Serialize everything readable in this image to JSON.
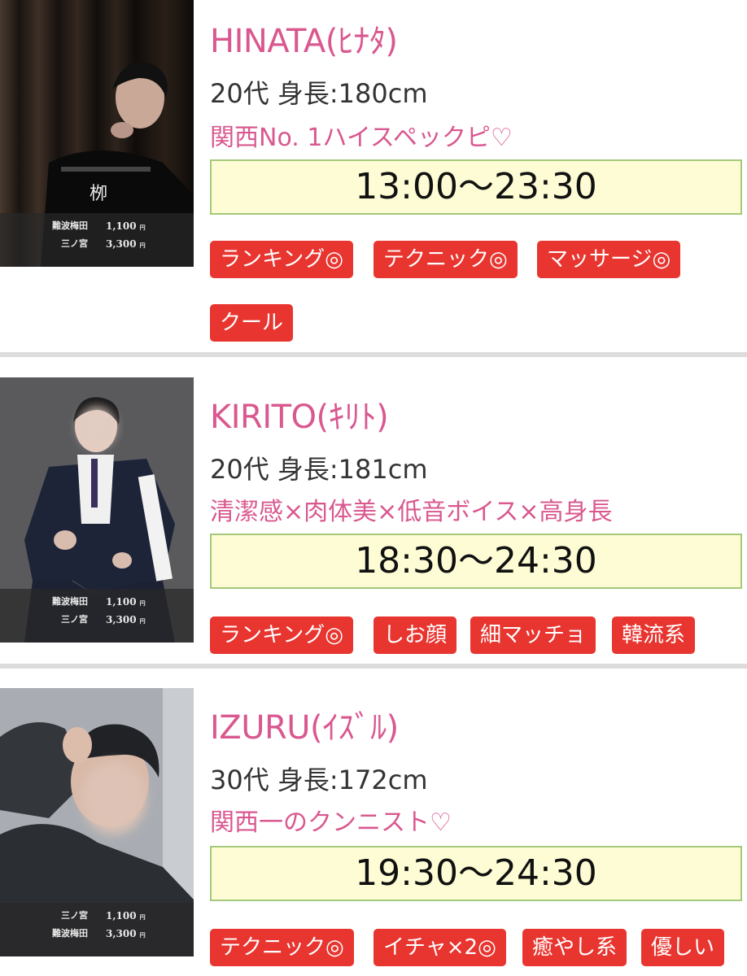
{
  "cast": [
    {
      "name": "HINATA(ﾋﾅﾀ)",
      "stats": "20代 身長:180cm",
      "catch": "関西No. 1ハイスペックピ♡",
      "schedule": "13:00〜23:30",
      "prices": [
        {
          "location": "難波梅田",
          "price": "1,100",
          "unit": "円"
        },
        {
          "location": "三ノ宮",
          "price": "3,300",
          "unit": "円"
        }
      ],
      "tags": [
        "ランキング◎",
        "テクニック◎",
        "マッサージ◎",
        "クール"
      ]
    },
    {
      "name": "KIRITO(ｷﾘﾄ)",
      "stats": "20代 身長:181cm",
      "catch": "清潔感×肉体美×低音ボイス×高身長",
      "schedule": "18:30〜24:30",
      "prices": [
        {
          "location": "難波梅田",
          "price": "1,100",
          "unit": "円"
        },
        {
          "location": "三ノ宮",
          "price": "3,300",
          "unit": "円"
        }
      ],
      "tags": [
        "ランキング◎",
        "しお顔",
        "細マッチョ",
        "韓流系"
      ]
    },
    {
      "name": "IZURU(ｲｽﾞﾙ)",
      "stats": "30代 身長:172cm",
      "catch": "関西一のクンニスト♡",
      "schedule": "19:30〜24:30",
      "prices": [
        {
          "location": "三ノ宮",
          "price": "1,100",
          "unit": "円"
        },
        {
          "location": "難波梅田",
          "price": "3,300",
          "unit": "円"
        }
      ],
      "tags": [
        "テクニック◎",
        "イチャ×2◎",
        "癒やし系",
        "優しい"
      ]
    }
  ],
  "colors": {
    "name_pink": "#d9588f",
    "tag_red": "#e8352f",
    "schedule_bg": "#fdfcd4",
    "schedule_border": "#a4c97a",
    "divider": "#dcdcdc"
  }
}
